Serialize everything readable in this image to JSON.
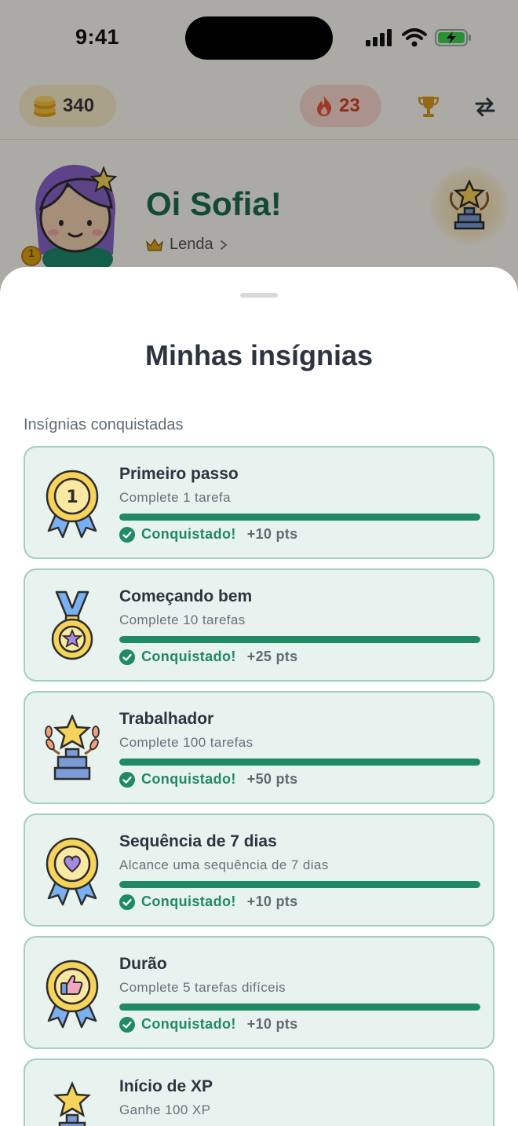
{
  "status_bar": {
    "time": "9:41"
  },
  "top_bar": {
    "coins": "340",
    "streak": "23"
  },
  "profile": {
    "greeting": "Oi Sofia!",
    "level": "Lenda",
    "avatar_level": "1"
  },
  "sheet": {
    "title": "Minhas insígnias",
    "section_label": "Insígnias conquistadas",
    "badges": [
      {
        "name": "Primeiro passo",
        "description": "Complete 1 tarefa",
        "status": "Conquistado!",
        "points": "+10 pts",
        "progress": 1.0,
        "icon": "medal-1-icon"
      },
      {
        "name": "Começando bem",
        "description": "Complete 10 tarefas",
        "status": "Conquistado!",
        "points": "+25 pts",
        "progress": 1.0,
        "icon": "star-medal-icon"
      },
      {
        "name": "Trabalhador",
        "description": "Complete 100 tarefas",
        "status": "Conquistado!",
        "points": "+50 pts",
        "progress": 1.0,
        "icon": "trophy-star-icon"
      },
      {
        "name": "Sequência de 7 dias",
        "description": "Alcance uma sequência de 7 dias",
        "status": "Conquistado!",
        "points": "+10 pts",
        "progress": 1.0,
        "icon": "heart-rosette-icon"
      },
      {
        "name": "Durão",
        "description": "Complete 5 tarefas difíceis",
        "status": "Conquistado!",
        "points": "+10 pts",
        "progress": 1.0,
        "icon": "thumbs-up-rosette-icon"
      },
      {
        "name": "Início de XP",
        "description": "Ganhe 100 XP",
        "status": "",
        "points": "",
        "progress": 1.0,
        "icon": "star-trophy-icon"
      }
    ]
  },
  "colors": {
    "accent": "#1f8a63",
    "card_bg": "#e8f2ee",
    "card_border": "#9fd1bd",
    "title": "#2c3440",
    "streak": "#d4412a"
  }
}
